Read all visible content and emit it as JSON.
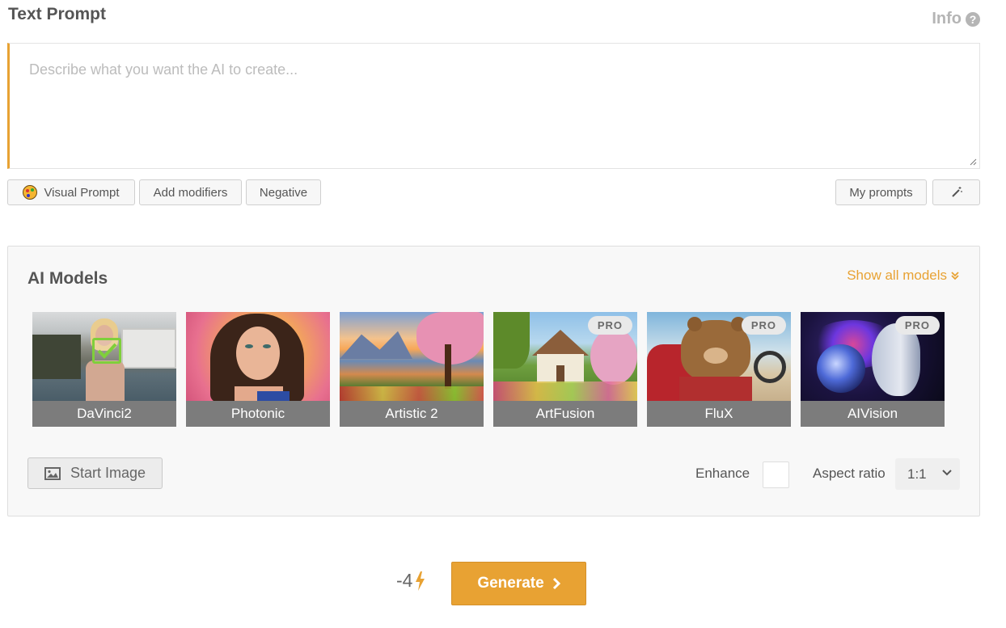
{
  "header": {
    "title": "Text Prompt",
    "info_label": "Info",
    "info_icon": "?"
  },
  "prompt": {
    "placeholder": "Describe what you want the AI to create...",
    "value": ""
  },
  "toolbar": {
    "visual_prompt": "Visual Prompt",
    "add_modifiers": "Add modifiers",
    "negative": "Negative",
    "my_prompts": "My prompts"
  },
  "models_panel": {
    "title": "AI Models",
    "show_all": "Show all models",
    "models": [
      {
        "name": "DaVinci2",
        "pro": false,
        "selected": true
      },
      {
        "name": "Photonic",
        "pro": false,
        "selected": false
      },
      {
        "name": "Artistic 2",
        "pro": false,
        "selected": false
      },
      {
        "name": "ArtFusion",
        "pro": true,
        "selected": false
      },
      {
        "name": "FluX",
        "pro": true,
        "selected": false
      },
      {
        "name": "AIVision",
        "pro": true,
        "selected": false
      }
    ],
    "pro_badge": "PRO",
    "start_image": "Start Image",
    "enhance_label": "Enhance",
    "enhance_checked": false,
    "aspect_label": "Aspect ratio",
    "aspect_value": "1:1"
  },
  "footer": {
    "cost": "-4",
    "generate": "Generate"
  },
  "colors": {
    "accent": "#e8a233",
    "label_bg": "#7c7c7c",
    "check": "#7fcf3b"
  }
}
